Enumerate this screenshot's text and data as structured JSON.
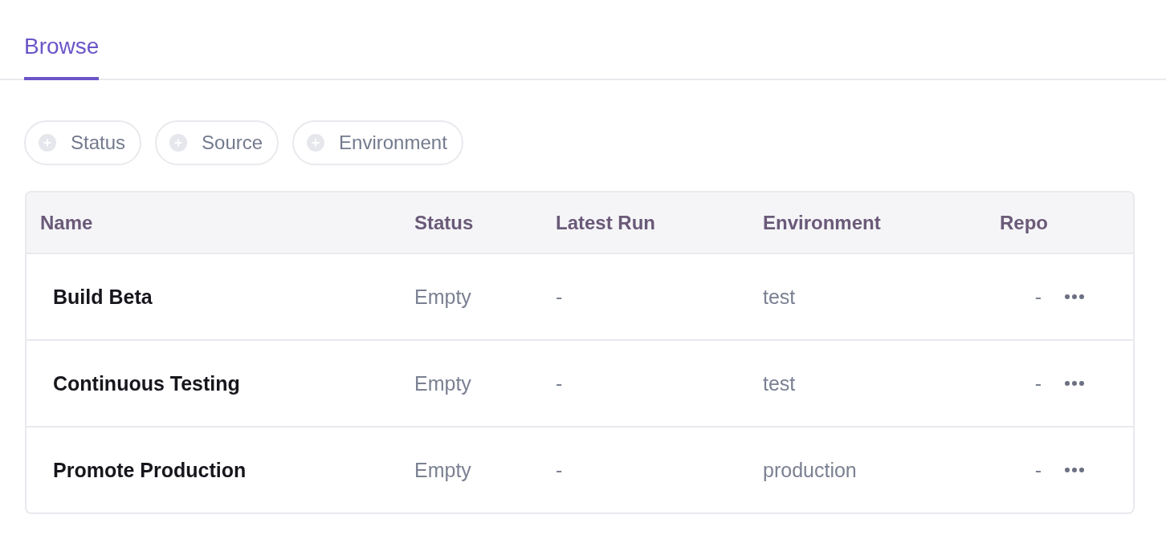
{
  "tabs": [
    {
      "label": "Browse",
      "selected": true
    }
  ],
  "filters": [
    {
      "label": "Status"
    },
    {
      "label": "Source"
    },
    {
      "label": "Environment"
    }
  ],
  "table": {
    "columns": [
      "Name",
      "Status",
      "Latest Run",
      "Environment",
      "Repo"
    ],
    "rows": [
      {
        "name": "Build Beta",
        "status": "Empty",
        "latest_run": "-",
        "environment": "test",
        "repo": "-"
      },
      {
        "name": "Continuous Testing",
        "status": "Empty",
        "latest_run": "-",
        "environment": "test",
        "repo": "-"
      },
      {
        "name": "Promote Production",
        "status": "Empty",
        "latest_run": "-",
        "environment": "production",
        "repo": "-"
      }
    ]
  }
}
